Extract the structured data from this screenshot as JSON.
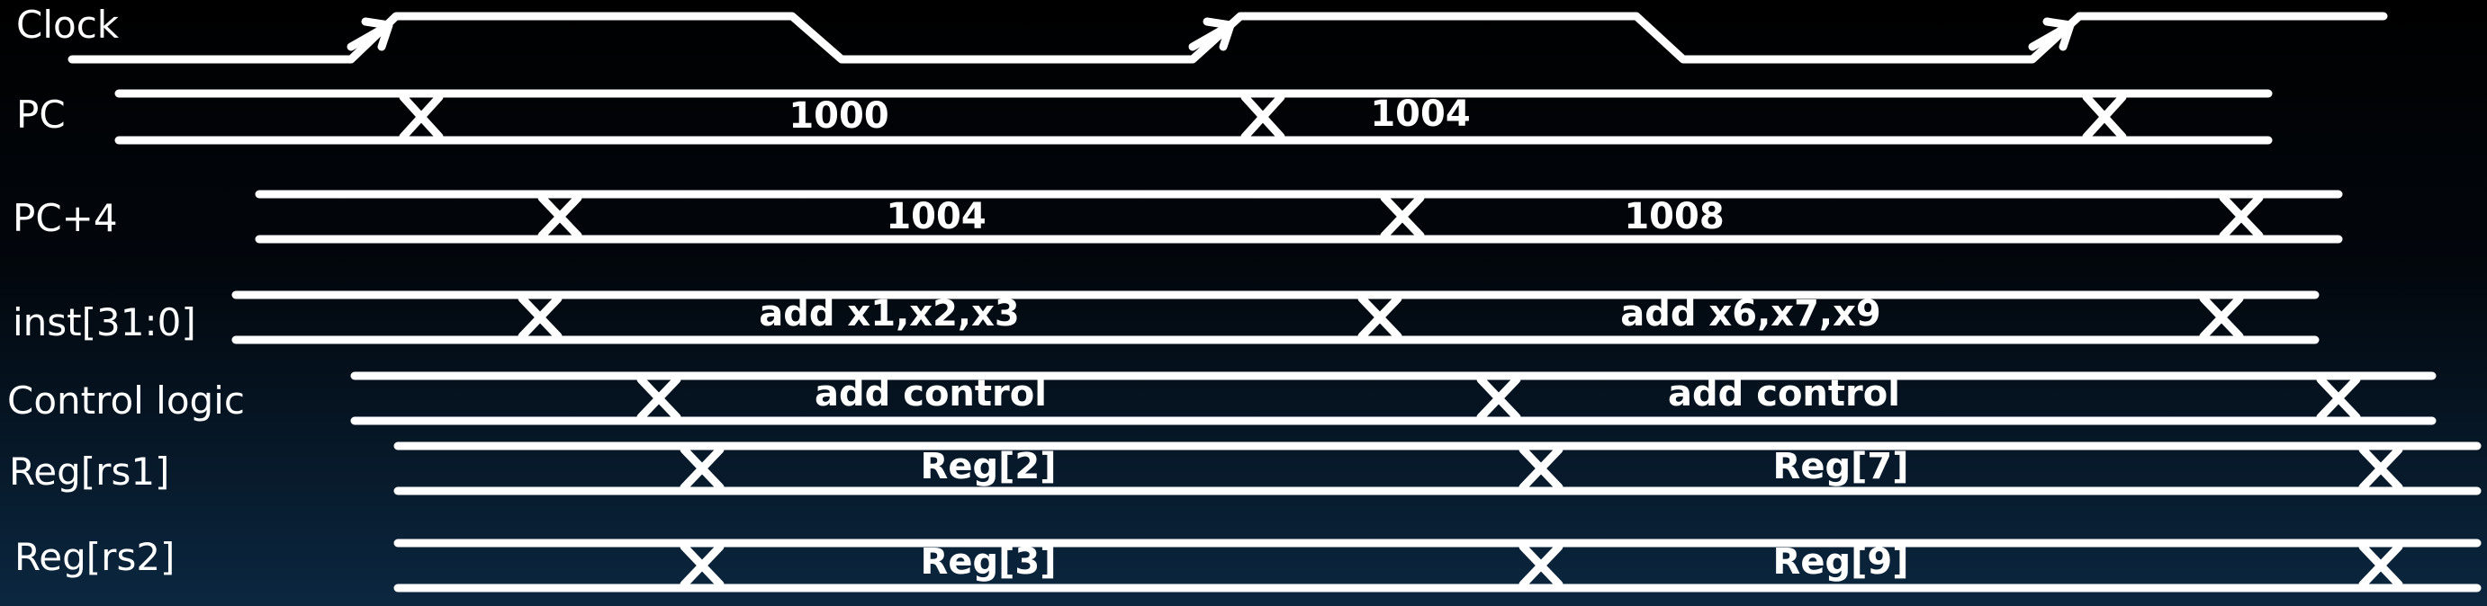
{
  "diagram": {
    "clock": {
      "label": "Clock"
    },
    "buses": [
      {
        "label": "PC",
        "values": [
          "1000",
          "1004"
        ]
      },
      {
        "label": "PC+4",
        "values": [
          "1004",
          "1008"
        ]
      },
      {
        "label": "inst[31:0]",
        "values": [
          "add x1,x2,x3",
          "add x6,x7,x9"
        ]
      },
      {
        "label": "Control logic",
        "values": [
          "add control",
          "add control"
        ]
      },
      {
        "label": "Reg[rs1]",
        "values": [
          "Reg[2]",
          "Reg[7]"
        ]
      },
      {
        "label": "Reg[rs2]",
        "values": [
          "Reg[3]",
          "Reg[9]"
        ]
      }
    ]
  }
}
